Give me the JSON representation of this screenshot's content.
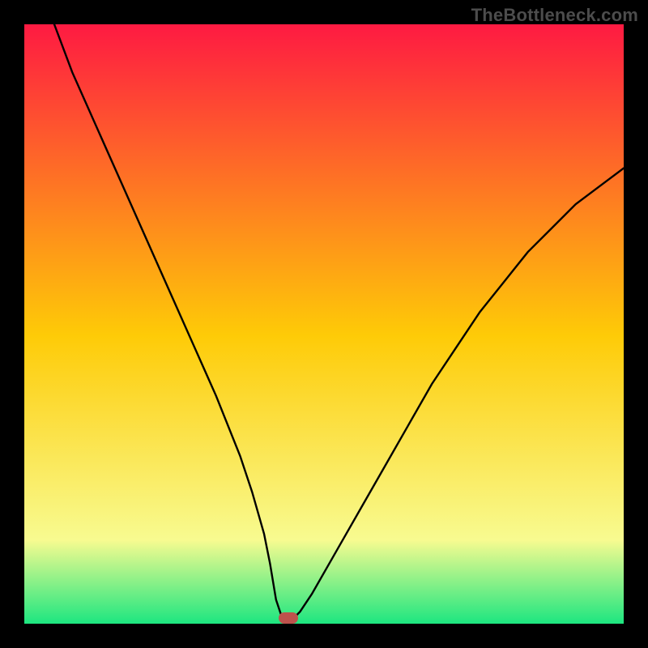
{
  "watermark": "TheBottleneck.com",
  "chart_data": {
    "type": "line",
    "title": "",
    "xlabel": "",
    "ylabel": "",
    "xlim": [
      0,
      100
    ],
    "ylim": [
      0,
      100
    ],
    "grid": false,
    "legend": false,
    "background_gradient": {
      "top_color": "#fe1a42",
      "mid_color": "#fecb07",
      "low_color": "#f8fb90",
      "bottom_color": "#1de680"
    },
    "series": [
      {
        "name": "bottleneck-curve",
        "color": "#000000",
        "x": [
          5,
          8,
          12,
          16,
          20,
          24,
          28,
          32,
          36,
          38,
          40,
          41,
          42,
          43,
          44,
          45,
          46,
          48,
          52,
          56,
          60,
          64,
          68,
          72,
          76,
          80,
          84,
          88,
          92,
          96,
          100
        ],
        "y": [
          100,
          92,
          83,
          74,
          65,
          56,
          47,
          38,
          28,
          22,
          15,
          10,
          4,
          1,
          1,
          1,
          2,
          5,
          12,
          19,
          26,
          33,
          40,
          46,
          52,
          57,
          62,
          66,
          70,
          73,
          76
        ]
      }
    ],
    "marker": {
      "x": 44,
      "y": 1,
      "color": "#bd524c"
    }
  }
}
